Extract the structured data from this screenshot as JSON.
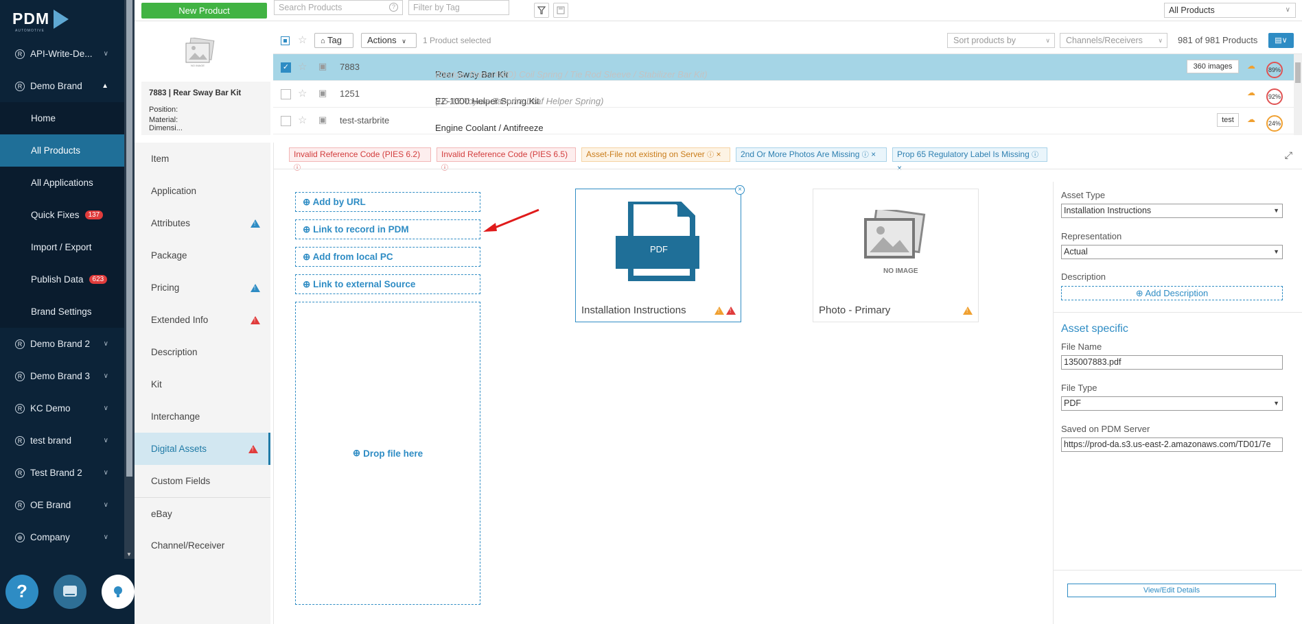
{
  "app": {
    "logo_text": "PDM",
    "logo_subtext": "AUTOMOTIVE"
  },
  "sidebar": {
    "items": [
      {
        "label": "API-Write-De...",
        "type": "brand"
      },
      {
        "label": "Demo Brand",
        "type": "brand-open"
      },
      {
        "label": "Home",
        "type": "sub"
      },
      {
        "label": "All Products",
        "type": "sub-active"
      },
      {
        "label": "All Applications",
        "type": "sub"
      },
      {
        "label": "Quick Fixes",
        "type": "sub",
        "badge": "137"
      },
      {
        "label": "Import / Export",
        "type": "sub"
      },
      {
        "label": "Publish Data",
        "type": "sub",
        "badge": "623"
      },
      {
        "label": "Brand Settings",
        "type": "sub"
      },
      {
        "label": "Demo Brand 2",
        "type": "brand"
      },
      {
        "label": "Demo Brand 3",
        "type": "brand"
      },
      {
        "label": "KC Demo",
        "type": "brand"
      },
      {
        "label": "test brand",
        "type": "brand"
      },
      {
        "label": "Test Brand 2",
        "type": "brand"
      },
      {
        "label": "OE Brand",
        "type": "brand"
      },
      {
        "label": "Company",
        "type": "globe"
      }
    ]
  },
  "topbar": {
    "new_product": "New Product",
    "search_placeholder": "Search Products",
    "tag_placeholder": "Filter by Tag",
    "view_select": "All Products"
  },
  "thumb_panel": {
    "title": "7883 | Rear Sway Bar Kit",
    "position_label": "Position:",
    "material_label": "Material:",
    "cut_label": "Dimensi...",
    "no_image": "NO IMAGE"
  },
  "product_toolbar": {
    "tag": "Tag",
    "actions": "Actions",
    "selected": "1 Product selected",
    "sort": "Sort products by",
    "channels": "Channels/Receivers",
    "count": "981 of 981 Products"
  },
  "products": [
    {
      "sku": "7883",
      "name": "Rear Sway Bar Kit",
      "sub": "(Dodge, Ram (4WD) Coil Spring / Tie Rod Sleeve / Stabilizer Bar Kit)",
      "extra": "360 images",
      "pct": "89%",
      "selected": true
    },
    {
      "sku": "1251",
      "name": "EZ-1000 Helper Spring Kit",
      "sub": "(05-15 Toyota Tacoma Leaf Helper Spring)",
      "extra": "",
      "pct": "92%",
      "selected": false
    },
    {
      "sku": "test-starbrite",
      "name": "Engine Coolant / Antifreeze",
      "sub": "",
      "extra": "test",
      "pct": "24%",
      "selected": false
    }
  ],
  "tabs": [
    {
      "label": "Item",
      "warn": ""
    },
    {
      "label": "Application",
      "warn": ""
    },
    {
      "label": "Attributes",
      "warn": "blue"
    },
    {
      "label": "Package",
      "warn": ""
    },
    {
      "label": "Pricing",
      "warn": "blue"
    },
    {
      "label": "Extended Info",
      "warn": "red"
    },
    {
      "label": "Description",
      "warn": ""
    },
    {
      "label": "Kit",
      "warn": ""
    },
    {
      "label": "Interchange",
      "warn": ""
    },
    {
      "label": "Digital Assets",
      "warn": "red",
      "active": true
    },
    {
      "label": "Custom Fields",
      "warn": ""
    },
    {
      "label": "eBay",
      "warn": ""
    },
    {
      "label": "Channel/Receiver",
      "warn": ""
    }
  ],
  "chips": [
    {
      "label": "Invalid Reference Code (PIES 6.2)",
      "color": "red",
      "close": false
    },
    {
      "label": "Invalid Reference Code (PIES 6.5)",
      "color": "red",
      "close": false
    },
    {
      "label": "Asset-File not existing on Server",
      "color": "orange",
      "close": true
    },
    {
      "label": "2nd Or More Photos Are Missing",
      "color": "blue",
      "close": true
    },
    {
      "label": "Prop 65 Regulatory Label Is Missing",
      "color": "blue",
      "close": true
    }
  ],
  "add_links": [
    "Add by URL",
    "Link to record in PDM",
    "Add from local PC",
    "Link to external Source"
  ],
  "drop_zone": "Drop file here",
  "assets": [
    {
      "label": "Installation Instructions",
      "icon_text": "PDF",
      "selected": true
    },
    {
      "label": "Photo - Primary",
      "icon_text": "NO IMAGE",
      "selected": false
    }
  ],
  "side_panel": {
    "asset_type_label": "Asset Type",
    "asset_type_value": "Installation Instructions",
    "representation_label": "Representation",
    "representation_value": "Actual",
    "description_label": "Description",
    "add_description": "Add Description",
    "asset_specific": "Asset specific",
    "file_name_label": "File Name",
    "file_name_value": "135007883.pdf",
    "file_type_label": "File Type",
    "file_type_value": "PDF",
    "saved_label": "Saved on PDM Server",
    "saved_value": "https://prod-da.s3.us-east-2.amazonaws.com/TD01/7e",
    "view_edit": "View/Edit Details"
  },
  "colors": {
    "accent": "#2e8cc4",
    "sidebar": "#0c2338",
    "active_nav": "#1f6f98",
    "green": "#41b343"
  }
}
